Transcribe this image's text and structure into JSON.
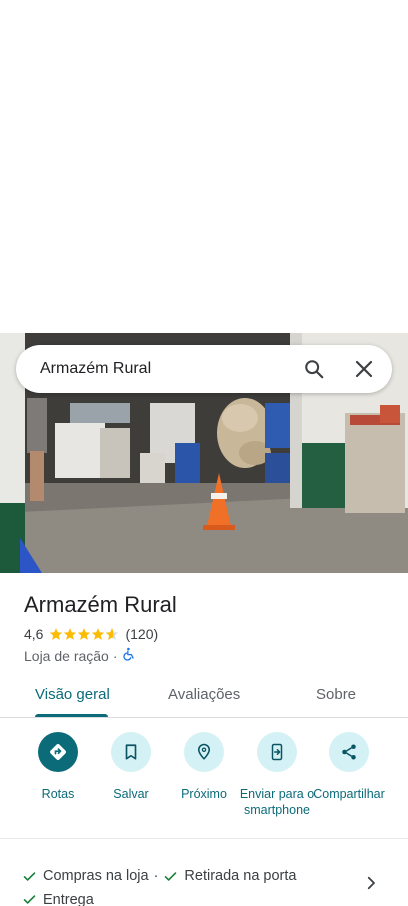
{
  "search": {
    "query": "Armazém Rural"
  },
  "place": {
    "name": "Armazém Rural",
    "rating": "4,6",
    "stars": 4.6,
    "review_count": "(120)",
    "category": "Loja de ração",
    "separator": "·"
  },
  "tabs": [
    {
      "label": "Visão geral",
      "active": true
    },
    {
      "label": "Avaliações"
    },
    {
      "label": "Sobre"
    }
  ],
  "actions": [
    {
      "label": "Rotas",
      "icon": "directions-icon"
    },
    {
      "label": "Salvar",
      "icon": "bookmark-icon"
    },
    {
      "label": "Próximo",
      "icon": "nearby-icon"
    },
    {
      "label": "Enviar para o smartphone",
      "icon": "send-to-phone-icon"
    },
    {
      "label": "Compartilhar",
      "icon": "share-icon"
    }
  ],
  "services": [
    {
      "label": "Compras na loja",
      "sep": "·"
    },
    {
      "label": "Retirada na porta"
    },
    {
      "label": "Entrega"
    }
  ],
  "colors": {
    "accent": "#0b6b79",
    "accent_light": "#d4f1f5",
    "star": "#fbbc04",
    "check": "#188038"
  }
}
